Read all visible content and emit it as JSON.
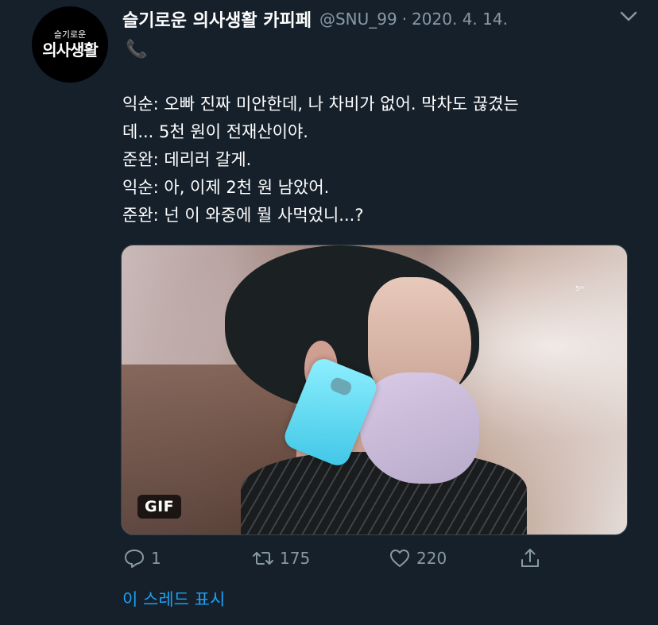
{
  "account": {
    "avatar_small": "슬기로운",
    "avatar_big": "의사생활",
    "name": "슬기로운 의사생활 카피페",
    "handle": "@SNU_99",
    "separator": "·",
    "date": "2020. 4. 14.",
    "emoji": "📞"
  },
  "tweet": {
    "lines": [
      "익순: 오빠 진짜 미안한데, 나 차비가 없어. 막차도 끊겼는",
      "데... 5천 원이 전재산이야.",
      "준완: 데리러 갈게.",
      "익순: 아, 이제 2천 원 남았어.",
      "준완: 넌 이 와중에 뭘 사먹었니...?"
    ]
  },
  "media": {
    "badge": "GIF",
    "watermark": "5ᵗʰ"
  },
  "actions": {
    "reply_count": "1",
    "retweet_count": "175",
    "like_count": "220"
  },
  "show_thread": "이 스레드 표시",
  "colors": {
    "background": "#15202b",
    "muted": "#8899a6",
    "link": "#1da1f2"
  },
  "icons": [
    "chevron-down-icon",
    "reply-icon",
    "retweet-icon",
    "like-icon",
    "share-icon"
  ]
}
